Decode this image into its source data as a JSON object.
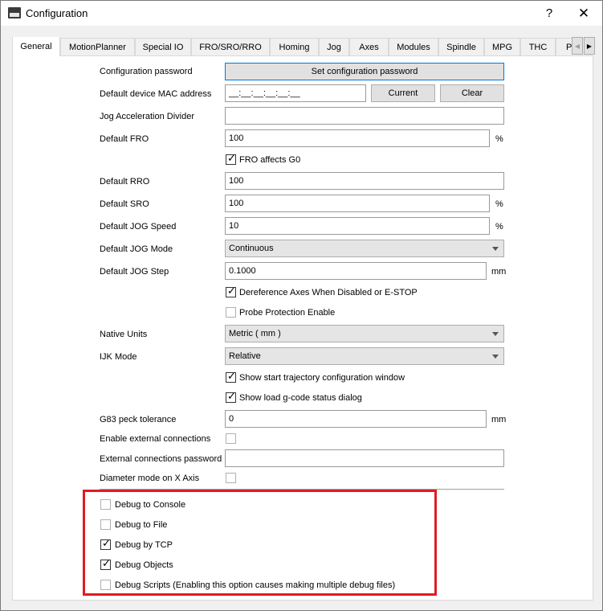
{
  "window": {
    "title": "Configuration",
    "help": "?",
    "close": "✕"
  },
  "tabs": [
    "General",
    "MotionPlanner",
    "Special IO",
    "FRO/SRO/RRO",
    "Homing",
    "Jog",
    "Axes",
    "Modules",
    "Spindle",
    "MPG",
    "THC",
    "P"
  ],
  "tab_scroll": {
    "left": "◀",
    "right": "▶"
  },
  "form": {
    "config_password": {
      "label": "Configuration password",
      "button": "Set configuration password"
    },
    "mac": {
      "label": "Default device MAC address",
      "value": "__:__:__:__:__:__",
      "current": "Current",
      "clear": "Clear"
    },
    "jog_accel": {
      "label": "Jog Acceleration Divider",
      "value": ""
    },
    "fro": {
      "label": "Default FRO",
      "value": "100",
      "unit": "%"
    },
    "fro_affects": {
      "label": "FRO affects G0",
      "checked": true
    },
    "rro": {
      "label": "Default RRO",
      "value": "100"
    },
    "sro": {
      "label": "Default SRO",
      "value": "100",
      "unit": "%"
    },
    "jog_speed": {
      "label": "Default JOG Speed",
      "value": "10",
      "unit": "%"
    },
    "jog_mode": {
      "label": "Default JOG Mode",
      "value": "Continuous"
    },
    "jog_step": {
      "label": "Default JOG Step",
      "value": "0.1000",
      "unit": "mm"
    },
    "deref": {
      "label": "Dereference Axes When Disabled or E-STOP",
      "checked": true
    },
    "probe": {
      "label": "Probe Protection Enable",
      "checked": false
    },
    "native_units": {
      "label": "Native Units",
      "value": "Metric ( mm )"
    },
    "ijk": {
      "label": "IJK Mode",
      "value": "Relative"
    },
    "show_traj": {
      "label": "Show start trajectory configuration window",
      "checked": true
    },
    "show_load": {
      "label": "Show load g-code status dialog",
      "checked": true
    },
    "g83": {
      "label": "G83 peck tolerance",
      "value": "0",
      "unit": "mm"
    },
    "ext_conn": {
      "label": "Enable external connections",
      "checked": false
    },
    "ext_pwd": {
      "label": "External connections password",
      "value": ""
    },
    "diameter": {
      "label": "Diameter mode on X Axis",
      "checked": false
    }
  },
  "debug": {
    "console": {
      "label": "Debug to Console",
      "checked": false
    },
    "file": {
      "label": "Debug to File",
      "checked": false
    },
    "tcp": {
      "label": "Debug by TCP",
      "checked": true
    },
    "objects": {
      "label": "Debug Objects",
      "checked": true
    },
    "scripts": {
      "label": "Debug Scripts (Enabling this option causes making multiple debug files)",
      "checked": false
    }
  },
  "colors": {
    "highlight": "#e11b22",
    "accent": "#0078d7"
  },
  "check_mark": "✓"
}
